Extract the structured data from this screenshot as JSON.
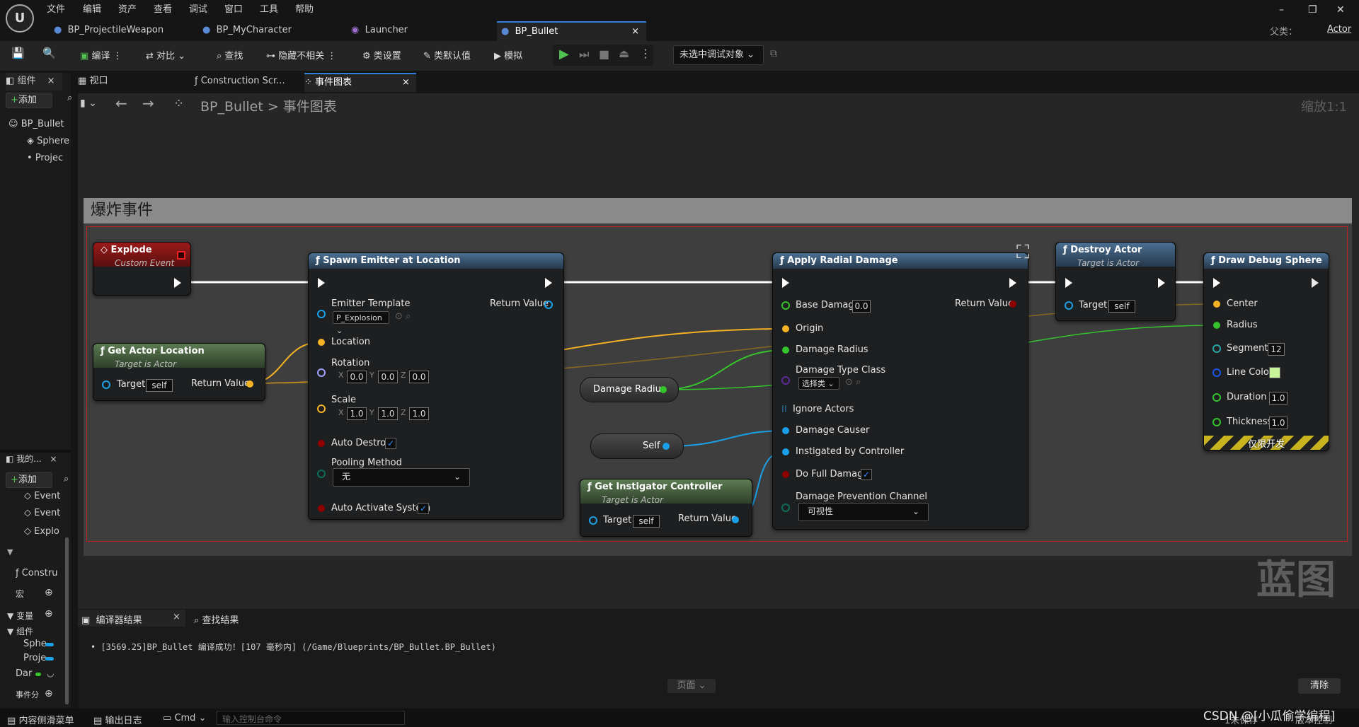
{
  "menu": [
    "文件",
    "编辑",
    "资产",
    "查看",
    "调试",
    "窗口",
    "工具",
    "帮助"
  ],
  "doc_tabs": [
    {
      "label": "BP_ProjectileWeapon"
    },
    {
      "label": "BP_MyCharacter"
    },
    {
      "label": "Launcher"
    },
    {
      "label": "BP_Bullet",
      "close": "×"
    }
  ],
  "parent_class": {
    "label": "父类：",
    "value": "Actor"
  },
  "window_controls": {
    "minimize": "–",
    "restore": "❐",
    "close": "✕"
  },
  "toolbar": {
    "compile": "编译",
    "diff": "对比",
    "find": "查找",
    "hide_unrelated": "隐藏不相关",
    "class_settings": "类设置",
    "class_defaults": "类默认值",
    "simulate": "模拟",
    "debug_object": "未选中调试对象"
  },
  "panel_tabs": {
    "components": "组件",
    "viewport": "视口",
    "construction": "Construction Scr...",
    "event_graph": "事件图表"
  },
  "components_panel": {
    "add": "添加",
    "items": [
      "BP_Bullet",
      "Sphere",
      "Projec"
    ]
  },
  "my_blueprint": {
    "title": "我的...",
    "add": "添加",
    "events": [
      "Event",
      "Event",
      "Explo"
    ],
    "construct": "Constru",
    "macros": "宏",
    "variables": "变量",
    "components_cat": "组件",
    "vars": [
      "Sphe",
      "Proje",
      "Dar"
    ],
    "dispatchers": "事件分"
  },
  "breadcrumb": {
    "root": "BP_Bullet",
    "sep": ">",
    "current": "事件图表"
  },
  "zoom": "缩放1:1",
  "comment": "爆炸事件",
  "watermark": "蓝图",
  "nodes": {
    "explode": {
      "title": "Explode",
      "subtitle": "Custom Event"
    },
    "get_actor_location": {
      "title": "Get Actor Location",
      "subtitle": "Target is Actor",
      "target": "Target",
      "self": "self",
      "ret": "Return Value"
    },
    "spawn_emitter": {
      "title": "Spawn Emitter at Location",
      "emitter_template": "Emitter Template",
      "emitter_value": "P_Explosion",
      "return_value": "Return Value",
      "location": "Location",
      "rotation": "Rotation",
      "rot": [
        "0.0",
        "0.0",
        "0.0"
      ],
      "scale": "Scale",
      "scl": [
        "1.0",
        "1.0",
        "1.0"
      ],
      "x": "X",
      "y": "Y",
      "z": "Z",
      "auto_destroy": "Auto Destroy",
      "pooling": "Pooling Method",
      "pooling_value": "无",
      "auto_activate": "Auto Activate System"
    },
    "damage_radius_var": "Damage Radius",
    "self_var": "Self",
    "get_instigator": {
      "title": "Get Instigator Controller",
      "subtitle": "Target is Actor",
      "target": "Target",
      "self": "self",
      "ret": "Return Value"
    },
    "apply_radial": {
      "title": "Apply Radial Damage",
      "base_damage": "Base Damage",
      "base_value": "0.0",
      "ret": "Return Value",
      "origin": "Origin",
      "damage_radius": "Damage Radius",
      "damage_type": "Damage Type Class",
      "damage_type_value": "选择类",
      "ignore_actors": "Ignore Actors",
      "damage_causer": "Damage Causer",
      "instigated": "Instigated by Controller",
      "full_damage": "Do Full Damage",
      "prevention": "Damage Prevention Channel",
      "prevention_value": "可视性"
    },
    "destroy_actor": {
      "title": "Destroy Actor",
      "subtitle": "Target is Actor",
      "target": "Target",
      "self": "self"
    },
    "draw_debug": {
      "title": "Draw Debug Sphere",
      "center": "Center",
      "radius": "Radius",
      "segments": "Segments",
      "segments_value": "12",
      "line_color": "Line Color",
      "duration": "Duration",
      "duration_value": "1.0",
      "thickness": "Thickness",
      "thickness_value": "1.0",
      "dev_only": "仅限开发"
    }
  },
  "bottom_panel": {
    "tab_compiler": "编译器结果",
    "tab_find": "查找结果",
    "log": "• [3569.25]BP_Bullet 编译成功！[107 毫秒内] (/Game/Blueprints/BP_Bullet.BP_Bullet)",
    "page": "页面",
    "clear": "清除"
  },
  "statusbar": {
    "content_drawer": "内容侧滑菜单",
    "output_log": "输出日志",
    "cmd": "Cmd",
    "console_placeholder": "输入控制台命令",
    "unsaved": "1未保存",
    "revision": "版本控制",
    "csdn": "CSDN @[小瓜偷学编程]"
  },
  "colors": {
    "accent": "#2f7fd6",
    "exec": "#ffffff",
    "vector": "#f5b324",
    "float": "#35c42c",
    "object": "#1aa0e8",
    "bool": "#8f0000",
    "struct": "#29a6a6"
  }
}
